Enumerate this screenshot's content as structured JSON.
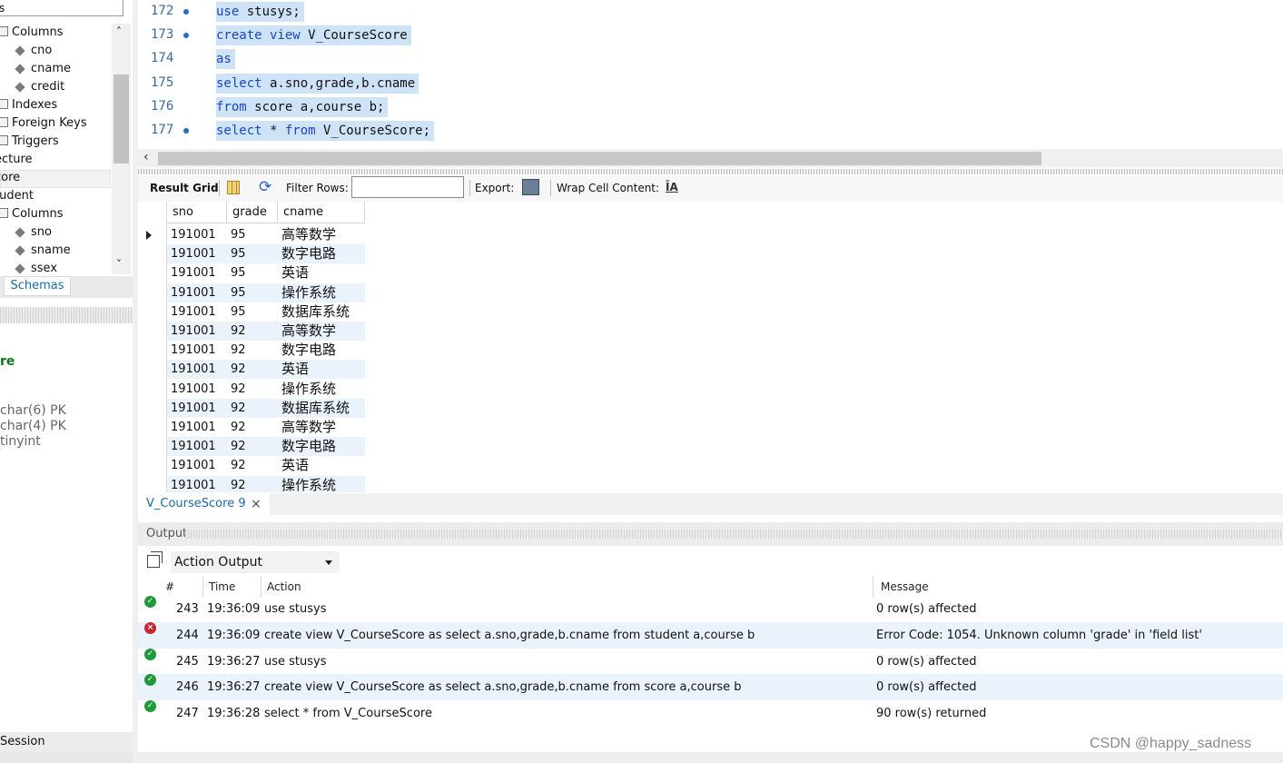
{
  "sidebar": {
    "tree": [
      {
        "label": "Columns",
        "icon": "table-icon",
        "kind": "folder"
      },
      {
        "label": "cno",
        "icon": "column-icon",
        "kind": "column"
      },
      {
        "label": "cname",
        "icon": "column-icon",
        "kind": "column"
      },
      {
        "label": "credit",
        "icon": "column-icon",
        "kind": "column"
      },
      {
        "label": "Indexes",
        "icon": "table-icon",
        "kind": "folder"
      },
      {
        "label": "Foreign Keys",
        "icon": "table-icon",
        "kind": "folder"
      },
      {
        "label": "Triggers",
        "icon": "table-icon",
        "kind": "folder"
      },
      {
        "label": "ecture",
        "icon": "",
        "kind": "table"
      },
      {
        "label": "core",
        "icon": "",
        "kind": "table"
      },
      {
        "label": "tudent",
        "icon": "",
        "kind": "table"
      },
      {
        "label": "Columns",
        "icon": "table-icon",
        "kind": "folder"
      },
      {
        "label": "sno",
        "icon": "column-icon",
        "kind": "column"
      },
      {
        "label": "sname",
        "icon": "column-icon",
        "kind": "column"
      },
      {
        "label": "ssex",
        "icon": "column-icon",
        "kind": "column"
      }
    ],
    "schemas_tab": "Schemas",
    "info": {
      "name": "re",
      "columns": [
        "char(6) PK",
        "char(4) PK",
        "tinyint"
      ]
    },
    "session_label": "Session"
  },
  "editor": {
    "lines": [
      {
        "num": "172",
        "dot": true,
        "tokens": [
          {
            "t": "use",
            "kw": true
          },
          {
            "t": " stusys;",
            "kw": false
          }
        ]
      },
      {
        "num": "173",
        "dot": true,
        "tokens": [
          {
            "t": "create view",
            "kw": true
          },
          {
            "t": " V_CourseScore",
            "kw": false
          }
        ]
      },
      {
        "num": "174",
        "dot": false,
        "tokens": [
          {
            "t": "as",
            "kw": true
          }
        ]
      },
      {
        "num": "175",
        "dot": false,
        "tokens": [
          {
            "t": "select",
            "kw": true
          },
          {
            "t": " a.sno,grade,b.cname",
            "kw": false
          }
        ]
      },
      {
        "num": "176",
        "dot": false,
        "tokens": [
          {
            "t": "from",
            "kw": true
          },
          {
            "t": " score a,course b;",
            "kw": false
          }
        ]
      },
      {
        "num": "177",
        "dot": true,
        "tokens": [
          {
            "t": "select",
            "kw": true
          },
          {
            "t": " * ",
            "kw": false
          },
          {
            "t": "from",
            "kw": true
          },
          {
            "t": " V_CourseScore;",
            "kw": false
          }
        ]
      }
    ]
  },
  "result_toolbar": {
    "result_grid": "Result Grid",
    "filter_rows": "Filter Rows:",
    "filter_value": "",
    "export": "Export:",
    "wrap": "Wrap Cell Content:"
  },
  "grid": {
    "columns": [
      "sno",
      "grade",
      "cname"
    ],
    "rows": [
      [
        "191001",
        "95",
        "高等数学"
      ],
      [
        "191001",
        "95",
        "数字电路"
      ],
      [
        "191001",
        "95",
        "英语"
      ],
      [
        "191001",
        "95",
        "操作系统"
      ],
      [
        "191001",
        "95",
        "数据库系统"
      ],
      [
        "191001",
        "92",
        "高等数学"
      ],
      [
        "191001",
        "92",
        "数字电路"
      ],
      [
        "191001",
        "92",
        "英语"
      ],
      [
        "191001",
        "92",
        "操作系统"
      ],
      [
        "191001",
        "92",
        "数据库系统"
      ],
      [
        "191001",
        "92",
        "高等数学"
      ],
      [
        "191001",
        "92",
        "数字电路"
      ],
      [
        "191001",
        "92",
        "英语"
      ],
      [
        "191001",
        "92",
        "操作系统"
      ]
    ]
  },
  "result_tab": {
    "label": "V_CourseScore 9",
    "close": "×"
  },
  "output": {
    "title": "Output",
    "selector": "Action Output",
    "headers": [
      "#",
      "Time",
      "Action",
      "Message"
    ],
    "rows": [
      {
        "status": "ok",
        "num": "243",
        "time": "19:36:09",
        "action": "use stusys",
        "message": "0 row(s) affected"
      },
      {
        "status": "error",
        "num": "244",
        "time": "19:36:09",
        "action": "create view V_CourseScore as select a.sno,grade,b.cname from student a,course b",
        "message": "Error Code: 1054. Unknown column 'grade' in 'field list'"
      },
      {
        "status": "ok",
        "num": "245",
        "time": "19:36:27",
        "action": "use stusys",
        "message": "0 row(s) affected"
      },
      {
        "status": "ok",
        "num": "246",
        "time": "19:36:27",
        "action": "create view V_CourseScore as select a.sno,grade,b.cname from score a,course b",
        "message": "0 row(s) affected"
      },
      {
        "status": "ok",
        "num": "247",
        "time": "19:36:28",
        "action": "select * from V_CourseScore",
        "message": "90 row(s) returned"
      }
    ]
  },
  "watermark": "CSDN @happy_sadness",
  "colors": {
    "keyword": "#1a45c8",
    "selection": "#cfe3f7",
    "ok": "#1f9a3a",
    "error": "#c8262f",
    "schemas_tab": "#1a6aa8"
  }
}
